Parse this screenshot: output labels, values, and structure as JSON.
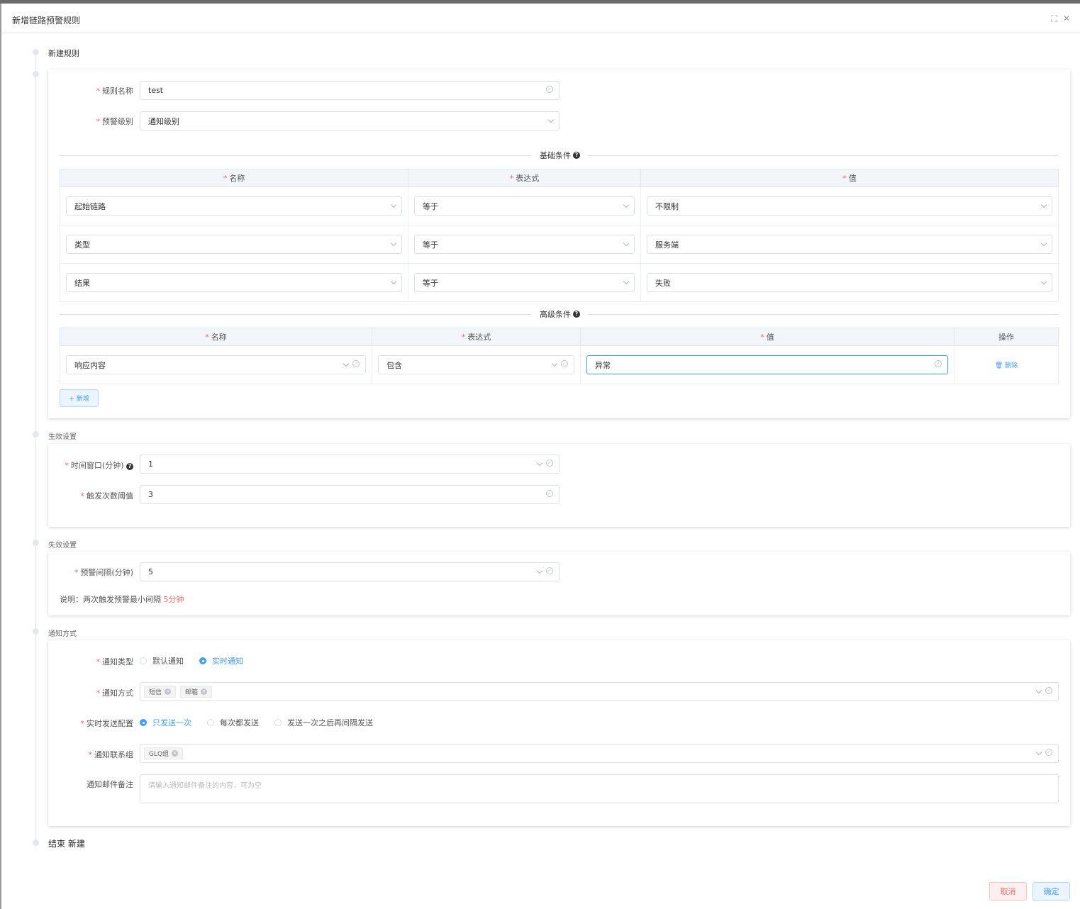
{
  "dialog": {
    "title": "新增链路预警规则",
    "maximize_icon": "⛶",
    "close_icon": "✕"
  },
  "timeline": {
    "start": "新建规则",
    "effect": "生效设置",
    "expire": "失效设置",
    "notify": "通知方式",
    "end": "结束 新建"
  },
  "rule": {
    "name_label": "规则名称",
    "name_value": "test",
    "level_label": "预警级别",
    "level_value": "通知级别"
  },
  "basic": {
    "title": "基础条件",
    "headers": [
      "名称",
      "表达式",
      "值"
    ],
    "rows": [
      {
        "name": "起始链路",
        "expr": "等于",
        "value": "不限制"
      },
      {
        "name": "类型",
        "expr": "等于",
        "value": "服务端"
      },
      {
        "name": "结果",
        "expr": "等于",
        "value": "失败"
      }
    ]
  },
  "advanced": {
    "title": "高级条件",
    "headers": [
      "名称",
      "表达式",
      "值",
      "操作"
    ],
    "rows": [
      {
        "name": "响应内容",
        "expr": "包含",
        "value": "异常",
        "action": "删除"
      }
    ],
    "add_label": "+ 新增"
  },
  "effect": {
    "window_label": "时间窗口(分钟)",
    "window_value": "1",
    "threshold_label": "触发次数阈值",
    "threshold_value": "3"
  },
  "expire": {
    "interval_label": "预警间隔(分钟)",
    "interval_value": "5",
    "note_prefix": "说明：两次触发预警最小间隔",
    "note_value": "5分钟"
  },
  "notify": {
    "type_label": "通知类型",
    "type_options": [
      "默认通知",
      "实时通知"
    ],
    "type_selected": "实时通知",
    "method_label": "通知方式",
    "methods": [
      "短信",
      "邮箱"
    ],
    "send_label": "实时发送配置",
    "send_options": [
      "只发送一次",
      "每次都发送",
      "发送一次之后再间隔发送"
    ],
    "send_selected": "只发送一次",
    "group_label": "通知联系组",
    "groups": [
      "GLQ组"
    ],
    "remark_label": "通知邮件备注",
    "remark_placeholder": "请输入通知邮件备注的内容，可为空"
  },
  "footer": {
    "cancel": "取消",
    "confirm": "确定"
  },
  "colors": {
    "primary": "#409eff",
    "danger": "#f56c6c"
  }
}
